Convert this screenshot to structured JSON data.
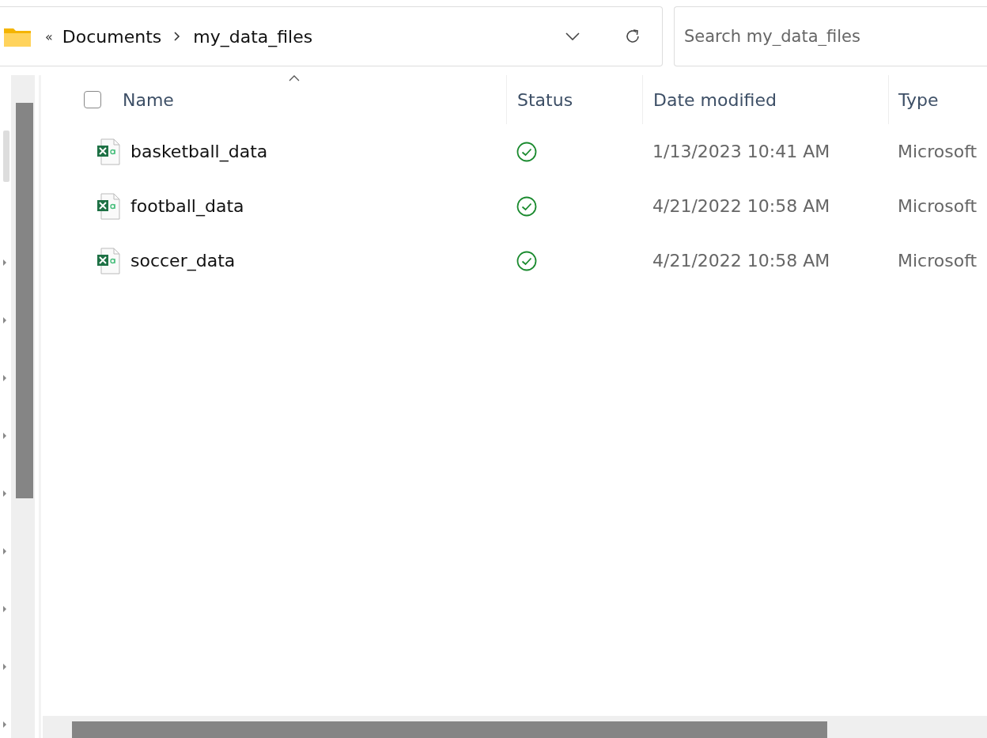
{
  "address_bar": {
    "overflow": "«",
    "path": [
      {
        "label": "Documents"
      },
      {
        "label": "my_data_files"
      }
    ]
  },
  "search": {
    "placeholder": "Search my_data_files"
  },
  "table": {
    "select_all": {
      "checked": false
    },
    "columns": [
      {
        "label": "Name",
        "sorted": true
      },
      {
        "label": "Status",
        "sorted": false
      },
      {
        "label": "Date modified",
        "sorted": false
      },
      {
        "label": "Type",
        "sorted": false
      }
    ],
    "rows": [
      {
        "name": "basketball_data",
        "synced": true,
        "date_modified": "1/13/2023 10:41 AM",
        "type": "Microsoft"
      },
      {
        "name": "football_data",
        "synced": true,
        "date_modified": "4/21/2022 10:58 AM",
        "type": "Microsoft"
      },
      {
        "name": "soccer_data",
        "synced": true,
        "date_modified": "4/21/2022 10:58 AM",
        "type": "Microsoft"
      }
    ]
  }
}
